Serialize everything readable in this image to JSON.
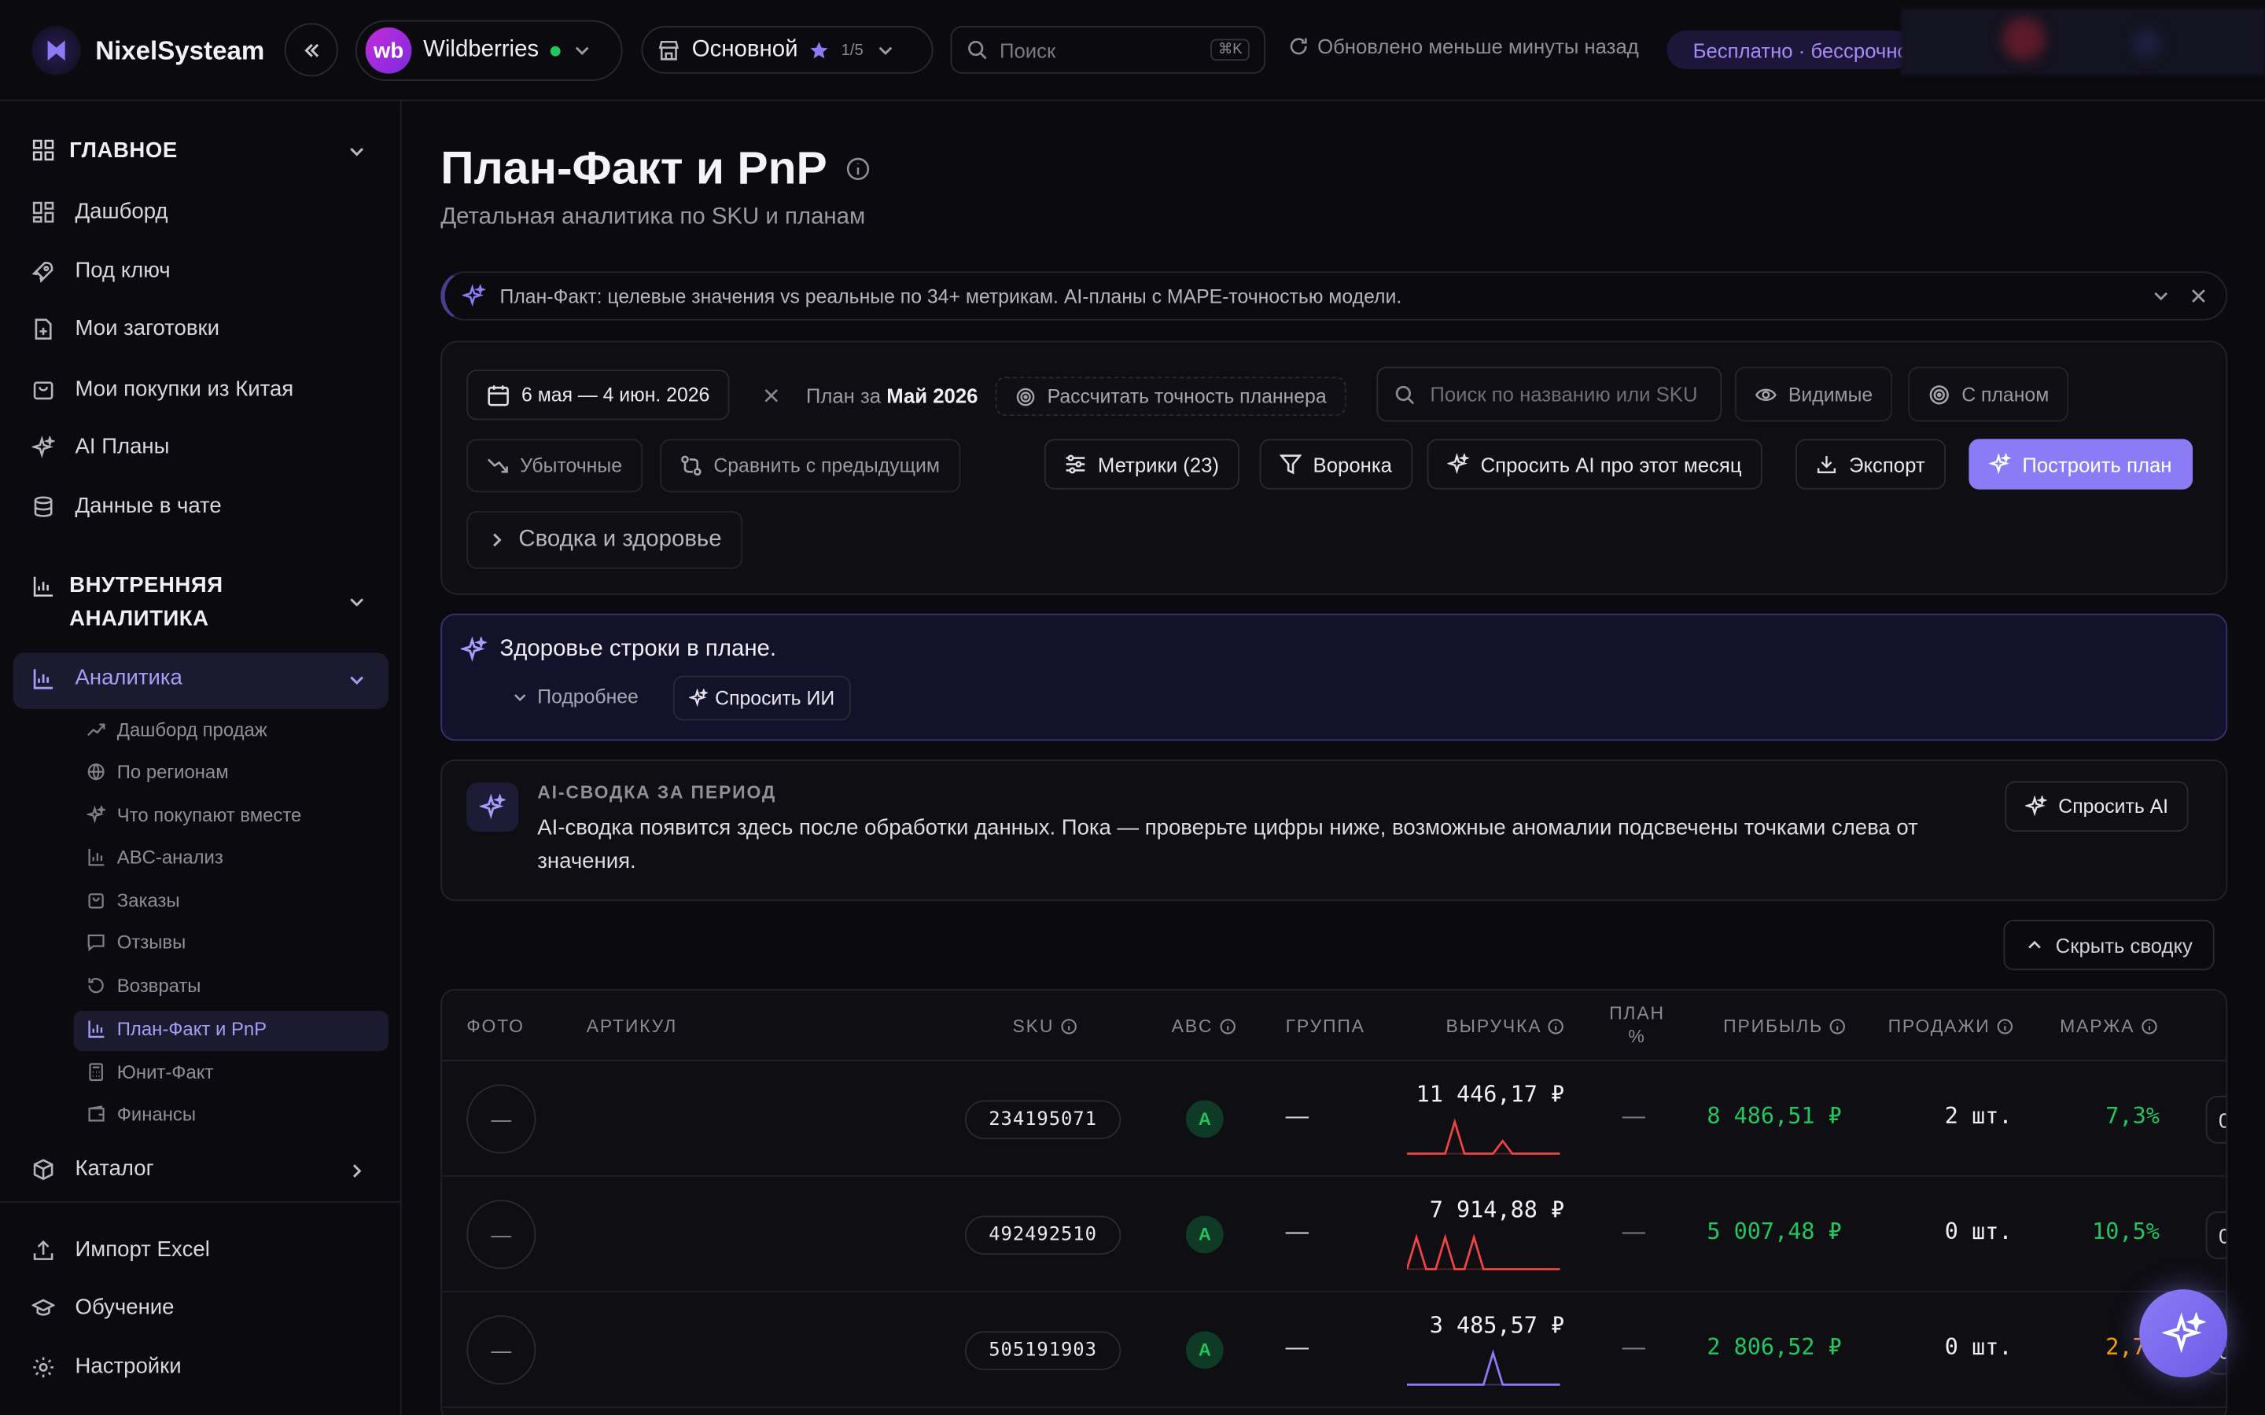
{
  "brand": {
    "name": "NixelSysteam"
  },
  "header": {
    "store_logo_text": "wb",
    "store_name": "Wildberries",
    "profile_name": "Основной",
    "profile_count": "1/5",
    "search_placeholder": "Поиск",
    "search_kbd": "⌘K",
    "updated_text": "Обновлено меньше минуты назад",
    "badge_text": "Бесплатно · бессрочно"
  },
  "sidebar": {
    "section_main": "ГЛАВНОЕ",
    "main_items": [
      {
        "label": "Дашборд"
      },
      {
        "label": "Под ключ"
      },
      {
        "label": "Мои заготовки"
      },
      {
        "label": "Мои покупки из Китая"
      },
      {
        "label": "AI Планы"
      },
      {
        "label": "Данные в чате"
      }
    ],
    "section_internal_line1": "ВНУТРЕННЯЯ",
    "section_internal_line2": "АНАЛИТИКА",
    "analytics_label": "Аналитика",
    "sub_items": [
      {
        "label": "Дашборд продаж"
      },
      {
        "label": "По регионам"
      },
      {
        "label": "Что покупают вместе"
      },
      {
        "label": "ABC-анализ"
      },
      {
        "label": "Заказы"
      },
      {
        "label": "Отзывы"
      },
      {
        "label": "Возвраты"
      },
      {
        "label": "План-Факт и PnP"
      },
      {
        "label": "Юнит-Факт"
      },
      {
        "label": "Финансы"
      }
    ],
    "catalog_label": "Каталог",
    "bottom_items": [
      {
        "label": "Импорт Excel"
      },
      {
        "label": "Обучение"
      },
      {
        "label": "Настройки"
      }
    ]
  },
  "page": {
    "title": "План-Факт и PnP",
    "subtitle": "Детальная аналитика по SKU и планам",
    "banner": "План-Факт: целевые значения vs реальные по 34+ метрикам. AI-планы с MAPE-точностью модели."
  },
  "filters": {
    "date_range": "6 мая — 4 июн. 2026",
    "plan_prefix": "План за",
    "plan_month": "Май 2026",
    "accuracy_btn": "Рассчитать точность планнера",
    "search_placeholder": "Поиск по названию или SKU",
    "visible_btn": "Видимые",
    "with_plan_btn": "С планом",
    "loss_btn": "Убыточные",
    "compare_btn": "Сравнить с предыдущим",
    "metrics_btn": "Метрики (23)",
    "funnel_btn": "Воронка",
    "ask_ai_month_btn": "Спросить AI про этот месяц",
    "export_btn": "Экспорт",
    "build_plan_btn": "Построить план",
    "summary_toggle": "Сводка и здоровье"
  },
  "health": {
    "title": "Здоровье строки в плане.",
    "details": "Подробнее",
    "ask": "Спросить ИИ"
  },
  "ai_summary": {
    "title": "AI-СВОДКА ЗА ПЕРИОД",
    "text": "AI-сводка появится здесь после обработки данных. Пока — проверьте цифры ниже, возможные аномалии подсвечены точками слева от значения.",
    "ask": "Спросить AI"
  },
  "hide_summary": "Скрыть сводку",
  "table": {
    "columns": {
      "photo": "ФОТО",
      "article": "АРТИКУЛ",
      "sku": "SKU",
      "abc": "ABC",
      "group": "ГРУППА",
      "revenue": "ВЫРУЧКА",
      "plan_line1": "ПЛАН",
      "plan_line2": "%",
      "profit": "ПРИБЫЛЬ",
      "sales": "ПРОДАЖИ",
      "margin": "МАРЖА"
    },
    "rows": [
      {
        "photo": "—",
        "sku": "234195071",
        "abc": "A",
        "group": "—",
        "revenue": "11 446,17 ₽",
        "plan": "—",
        "profit": "8 486,51 ₽",
        "sales": "2 шт.",
        "margin": "7,3%",
        "extra": "0",
        "margin_color": "#22c55e",
        "spark_color": "#ef4444",
        "spark": [
          0,
          0,
          0,
          0,
          0,
          1,
          0,
          0,
          0,
          0,
          0.4,
          0,
          0,
          0,
          0,
          0,
          0
        ]
      },
      {
        "photo": "—",
        "sku": "492492510",
        "abc": "A",
        "group": "—",
        "revenue": "7 914,88 ₽",
        "plan": "—",
        "profit": "5 007,48 ₽",
        "sales": "0 шт.",
        "margin": "10,5%",
        "extra": "0",
        "margin_color": "#22c55e",
        "spark_color": "#ef4444",
        "spark": [
          0,
          1,
          0,
          0,
          1,
          0,
          0,
          1,
          0,
          0,
          0,
          0,
          0,
          0,
          0,
          0,
          0
        ]
      },
      {
        "photo": "—",
        "sku": "505191903",
        "abc": "A",
        "group": "—",
        "revenue": "3 485,57 ₽",
        "plan": "—",
        "profit": "2 806,52 ₽",
        "sales": "0 шт.",
        "margin": "2,7%",
        "extra": "0",
        "margin_color": "#f59e0b",
        "spark_color": "#8b7cf6",
        "spark": [
          0,
          0,
          0,
          0,
          0,
          0,
          0,
          0,
          0,
          1,
          0,
          0,
          0,
          0,
          0,
          0,
          0
        ]
      }
    ]
  },
  "colors": {
    "accent": "#8b7cf6",
    "positive": "#22c55e",
    "warning": "#f59e0b",
    "negative": "#ef4444",
    "background": "#0b0b0f"
  },
  "icons": {
    "brand": "nixel-logo-icon",
    "fab": "sparkles-icon"
  }
}
